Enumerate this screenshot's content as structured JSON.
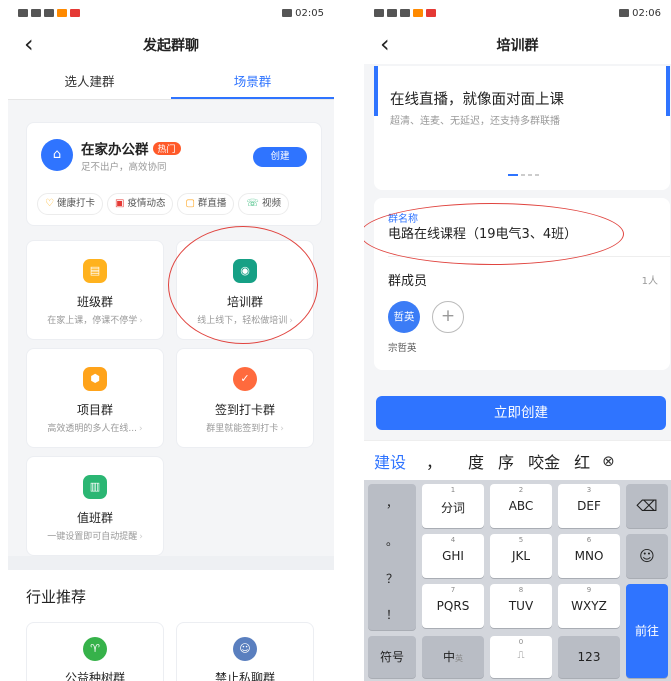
{
  "left": {
    "status": {
      "right": "02:05"
    },
    "title": "发起群聊",
    "tabs": [
      "选人建群",
      "场景群"
    ],
    "home_card": {
      "title": "在家办公群",
      "hot": "热门",
      "subtitle": "足不出户，高效协同",
      "create": "创建",
      "chips": [
        "健康打卡",
        "疫情动态",
        "群直播",
        "视频"
      ]
    },
    "grid": [
      {
        "name": "班级群",
        "sub": "在家上课，停课不停学",
        "color": "#ffb21e"
      },
      {
        "name": "培训群",
        "sub": "线上线下，轻松做培训",
        "color": "#16a085"
      },
      {
        "name": "项目群",
        "sub": "高效透明的多人在线...",
        "color": "#ffa31a"
      },
      {
        "name": "签到打卡群",
        "sub": "群里就能签到打卡",
        "color": "#ff6a3d"
      },
      {
        "name": "值班群",
        "sub": "一键设置即可自动提醒",
        "color": "#2bb673"
      }
    ],
    "section_title": "行业推荐",
    "industry": [
      {
        "name": "公益种树群",
        "color": "#36b24a"
      },
      {
        "name": "禁止私聊群",
        "color": "#5a7fbf"
      }
    ]
  },
  "right": {
    "status": {
      "right": "02:06"
    },
    "title": "培训群",
    "banner": {
      "title": "在线直播，就像面对面上课",
      "subtitle": "超清、连麦、无延迟，还支持多群联播"
    },
    "group_name_label": "群名称",
    "group_name_value": "电路在线课程（19电气3、4班）",
    "members_label": "群成员",
    "members_count": "1人",
    "member_avatar_text": "哲英",
    "member_name": "宗哲英",
    "create_button": "立即创建",
    "suggestions": [
      "建设",
      "，",
      "度",
      "序",
      "咬金",
      "红"
    ],
    "keyboard": {
      "punct_col": [
        "，",
        "。",
        "？",
        "！"
      ],
      "rows": [
        [
          {
            "n": "1",
            "l": "分词"
          },
          {
            "n": "2",
            "l": "ABC"
          },
          {
            "n": "3",
            "l": "DEF"
          }
        ],
        [
          {
            "n": "4",
            "l": "GHI"
          },
          {
            "n": "5",
            "l": "JKL"
          },
          {
            "n": "6",
            "l": "MNO"
          }
        ],
        [
          {
            "n": "7",
            "l": "PQRS"
          },
          {
            "n": "8",
            "l": "TUV"
          },
          {
            "n": "9",
            "l": "WXYZ"
          }
        ]
      ],
      "bottom": {
        "symbols": "符号",
        "chinese": "中",
        "chinese_sub": "英",
        "zero": "0",
        "num": "123"
      },
      "go": "前往"
    }
  }
}
